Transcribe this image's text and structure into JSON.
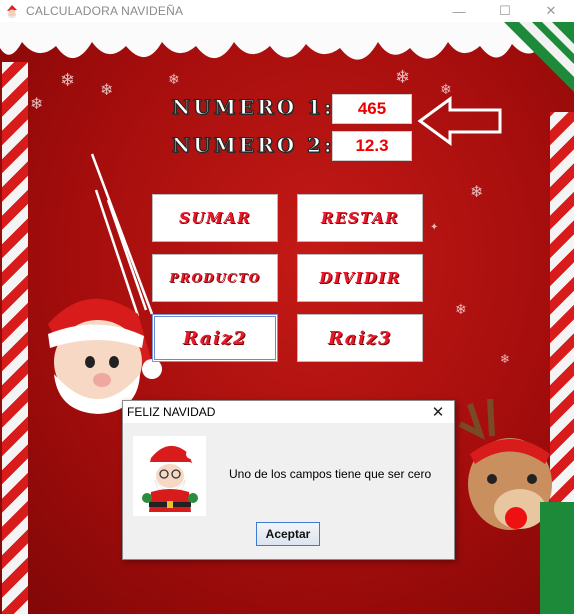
{
  "window": {
    "title": "CALCULADORA NAVIDEÑA",
    "minimize_symbol": "—",
    "maximize_symbol": "☐",
    "close_symbol": "✕"
  },
  "form": {
    "label1": "NUMERO 1:",
    "value1": "465",
    "label2": "NUMERO 2:",
    "value2": "12.3"
  },
  "buttons": {
    "sumar": "SUMAR",
    "restar": "RESTAR",
    "producto": "PRODUCTO",
    "dividir": "DIVIDIR",
    "raiz2": "Raiz2",
    "raiz3": "Raiz3"
  },
  "dialog": {
    "title": "FELIZ NAVIDAD",
    "message": "Uno de los campos tiene que ser cero",
    "ok_label": "Aceptar",
    "close_symbol": "✕"
  },
  "icons": {
    "app": "santa-icon",
    "dialog": "santa-image"
  },
  "colors": {
    "background": "#b0100f",
    "field_text": "#e00000",
    "button_text": "#e8192c"
  }
}
